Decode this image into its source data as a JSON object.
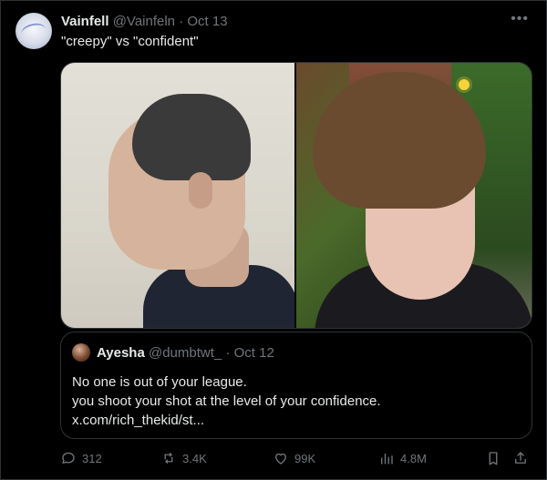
{
  "tweet": {
    "author": {
      "name": "Vainfell",
      "handle": "@Vainfeln",
      "separator": "·",
      "date": "Oct 13"
    },
    "text": "\"creepy\" vs \"confident\"",
    "more_icon": "more-horizontal-icon"
  },
  "quote": {
    "author": {
      "name": "Ayesha",
      "handle": "@dumbtwt_",
      "separator": "·",
      "date": "Oct 12"
    },
    "lines": [
      "No one is out of your league.",
      "you shoot your shot at the level of your confidence.",
      "x.com/rich_thekid/st..."
    ]
  },
  "actions": {
    "reply": {
      "icon": "reply-icon",
      "count": "312"
    },
    "retweet": {
      "icon": "retweet-icon",
      "count": "3.4K"
    },
    "like": {
      "icon": "heart-icon",
      "count": "99K"
    },
    "views": {
      "icon": "views-icon",
      "count": "4.8M"
    },
    "bookmark": {
      "icon": "bookmark-icon"
    },
    "share": {
      "icon": "share-icon"
    }
  },
  "colors": {
    "background": "#000000",
    "primary_text": "#e7e9ea",
    "secondary_text": "#71767b",
    "border": "#2f3336"
  }
}
